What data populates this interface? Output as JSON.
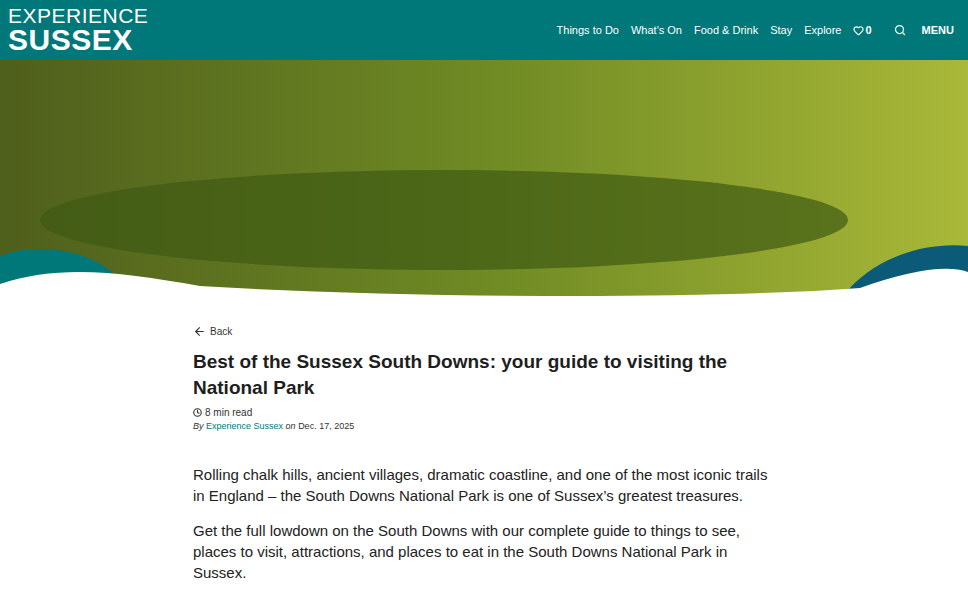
{
  "header": {
    "logo": {
      "top": "EXPERIENCE",
      "bottom": "SUSSEX"
    },
    "nav": [
      "Things to Do",
      "What's On",
      "Food & Drink",
      "Stay",
      "Explore"
    ],
    "favourites_count": "0",
    "menu": "MENU"
  },
  "article": {
    "back": "Back",
    "title": "Best of the Sussex South Downs: your guide to visiting the National Park",
    "read_time": "8 min read",
    "byline": {
      "prefix": "By",
      "author": "Experience Sussex",
      "date_prefix": "on",
      "date": "Dec. 17, 2025"
    },
    "paragraphs": [
      "Rolling chalk hills, ancient villages, dramatic coastline, and one of the most iconic trails in England – the South Downs National Park is one of Sussex’s greatest treasures.",
      "Get the full lowdown on the South Downs with our complete guide to things to see, places to visit, attractions, and places to eat in the South Downs National Park in Sussex."
    ]
  }
}
